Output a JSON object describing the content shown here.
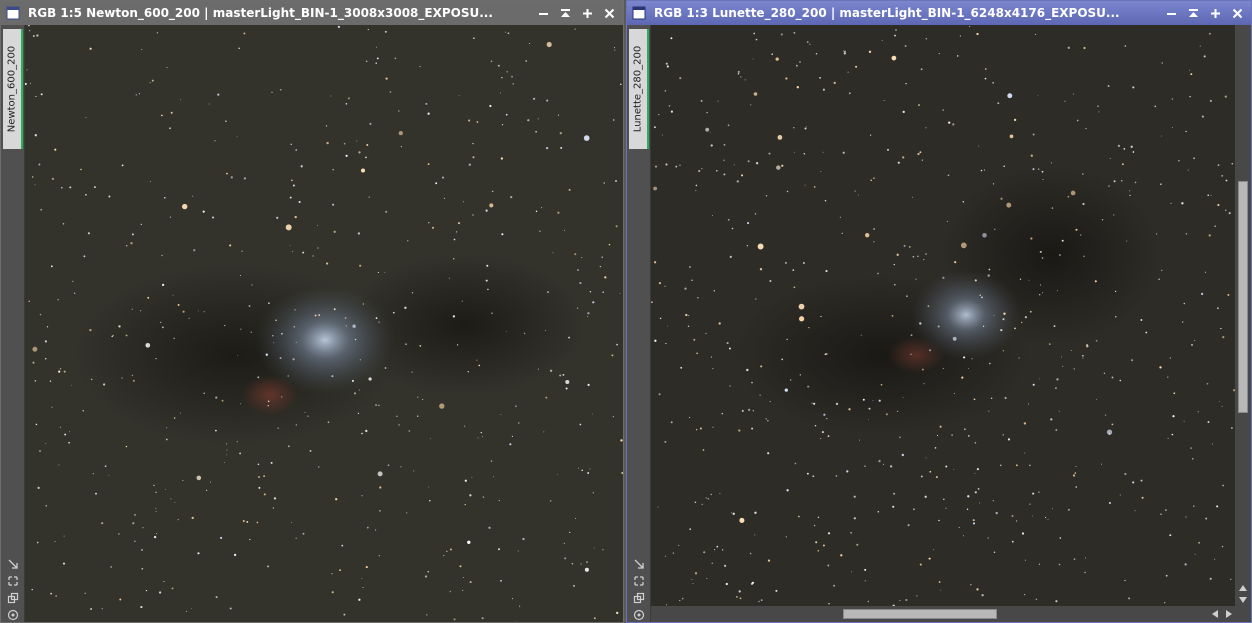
{
  "windows": [
    {
      "title": "RGB 1:5 Newton_600_200 | masterLight_BIN-1_3008x3008_EXPOSU...",
      "tab_label": "Newton_600_200",
      "active": false
    },
    {
      "title": "RGB 1:3 Lunette_280_200 | masterLight_BIN-1_6248x4176_EXPOSU...",
      "tab_label": "Lunette_280_200",
      "active": true
    }
  ],
  "title_buttons": [
    "minimize-icon",
    "shade-icon",
    "maximize-icon",
    "close-icon"
  ],
  "side_icons": [
    "fit-view-icon",
    "zoom-icon",
    "clone-icon",
    "target-icon"
  ],
  "colors": {
    "active_title": "#6a74c4",
    "inactive_title": "#6b6b6b",
    "tab_accent": "#27b15a",
    "sky_background": "#2f2e29",
    "nebula": "#b7c8e6"
  },
  "scrollbars": {
    "win2_vertical_position": 0.27,
    "win2_horizontal_position": 0.34
  }
}
